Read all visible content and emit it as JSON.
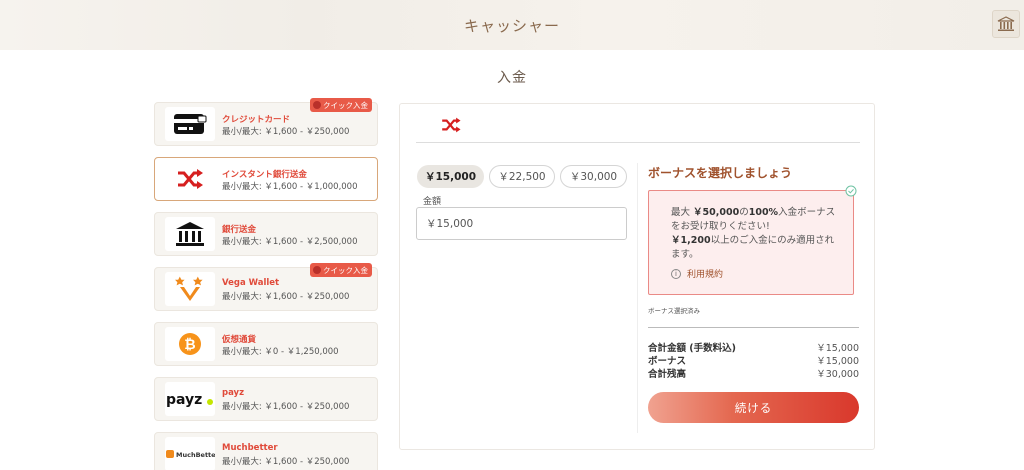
{
  "header": {
    "title": "キャッシャー",
    "bank_icon": "bank-icon"
  },
  "page": {
    "title": "入金"
  },
  "methods": [
    {
      "name": "クレジットカード",
      "range": "最小/最大: ￥1,600 - ￥250,000",
      "icon": "credit-card-icon",
      "quick": true
    },
    {
      "name": "インスタント銀行送金",
      "range": "最小/最大: ￥1,600 - ￥1,000,000",
      "icon": "shuffle-icon",
      "quick": false
    },
    {
      "name": "銀行送金",
      "range": "最小/最大: ￥1,600 - ￥2,500,000",
      "icon": "bank-icon",
      "quick": false
    },
    {
      "name": "Vega Wallet",
      "range": "最小/最大: ￥1,600 - ￥250,000",
      "icon": "vega-wallet-icon",
      "quick": true
    },
    {
      "name": "仮想通貨",
      "range": "最小/最大: ￥0 - ￥1,250,000",
      "icon": "bitcoin-icon",
      "quick": false
    },
    {
      "name": "payz",
      "range": "最小/最大: ￥1,600 - ￥250,000",
      "icon": "payz-logo",
      "logo_text": "payz",
      "quick": false
    },
    {
      "name": "Muchbetter",
      "range": "最小/最大: ￥1,600 - ￥250,000",
      "icon": "muchbetter-logo",
      "logo_text": "MuchBetter",
      "quick": false
    }
  ],
  "quick_badge_label": "クイック入金",
  "amounts": {
    "options": [
      "￥15,000",
      "￥22,500",
      "￥30,000"
    ],
    "label": "金額",
    "input_value": "￥15,000"
  },
  "bonus": {
    "title": "ボーナスを選択しましょう",
    "line1_pre": "最大 ",
    "line1_max": "￥50,000",
    "line1_mid": "の",
    "line1_pct": "100%",
    "line1_post": "入金ボーナスをお受け取りください!",
    "line2_min": "￥1,200",
    "line2_post": "以上のご入金にのみ適用されます。",
    "terms": "利用規約",
    "selected_note": "ボーナス選択済み"
  },
  "summary": {
    "rows": [
      {
        "label": "合計金額 (手数料込)",
        "value": "￥15,000"
      },
      {
        "label": "ボーナス",
        "value": "￥15,000"
      },
      {
        "label": "合計残高",
        "value": "￥30,000"
      }
    ],
    "continue_label": "続ける"
  },
  "colors": {
    "accent": "#e04a3a",
    "brown": "#a0522d",
    "badge": "#e85a48"
  }
}
